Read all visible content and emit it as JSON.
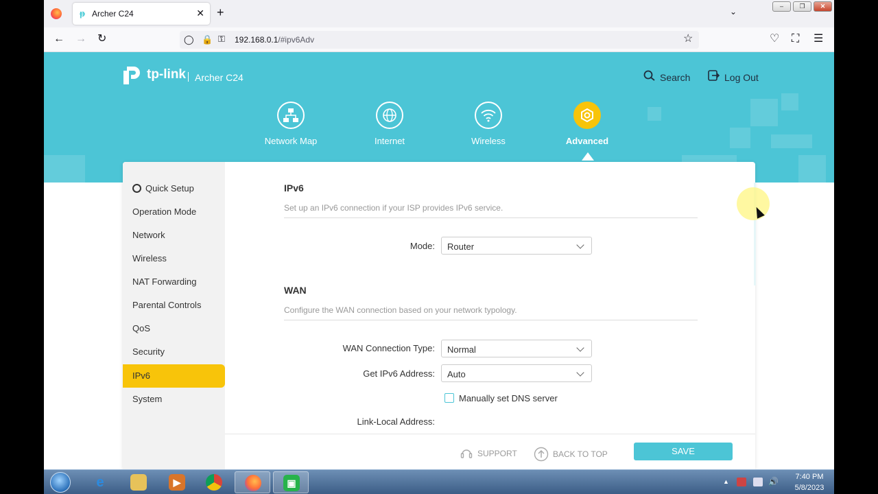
{
  "browser": {
    "tab_title": "Archer C24",
    "new_tab_symbol": "+",
    "close_symbol": "✕",
    "url_host": "192.168.0.1",
    "url_path": "/#ipv6Adv"
  },
  "router": {
    "brand": "tp-link",
    "model": "Archer C24",
    "search_label": "Search",
    "logout_label": "Log Out",
    "top_nav": [
      {
        "label": "Network Map",
        "icon": "network-map-icon"
      },
      {
        "label": "Internet",
        "icon": "globe-icon"
      },
      {
        "label": "Wireless",
        "icon": "wifi-icon"
      },
      {
        "label": "Advanced",
        "icon": "gear-icon",
        "active": true
      }
    ],
    "sidebar": [
      {
        "label": "Quick Setup"
      },
      {
        "label": "Operation Mode"
      },
      {
        "label": "Network"
      },
      {
        "label": "Wireless"
      },
      {
        "label": "NAT Forwarding"
      },
      {
        "label": "Parental Controls"
      },
      {
        "label": "QoS"
      },
      {
        "label": "Security"
      },
      {
        "label": "IPv6",
        "active": true
      },
      {
        "label": "System"
      }
    ],
    "ipv6": {
      "title": "IPv6",
      "description": "Set up an IPv6 connection if your ISP provides IPv6 service.",
      "mode_label": "Mode:",
      "mode_value": "Router"
    },
    "wan": {
      "title": "WAN",
      "description": "Configure the WAN connection based on your network typology.",
      "conn_type_label": "WAN Connection Type:",
      "conn_type_value": "Normal",
      "get_ipv6_label": "Get IPv6 Address:",
      "get_ipv6_value": "Auto",
      "manual_dns_label": "Manually set DNS server",
      "manual_dns_checked": false,
      "link_local_label": "Link-Local Address:"
    },
    "footer": {
      "support": "SUPPORT",
      "back_to_top": "BACK TO TOP",
      "save": "SAVE"
    },
    "colors": {
      "header": "#4cc5d6",
      "accent": "#f8c40a"
    }
  },
  "taskbar": {
    "apps": [
      "internet-explorer",
      "file-explorer",
      "media-player",
      "chrome",
      "firefox",
      "screen-capture"
    ],
    "time": "7:40 PM",
    "date": "5/8/2023"
  }
}
